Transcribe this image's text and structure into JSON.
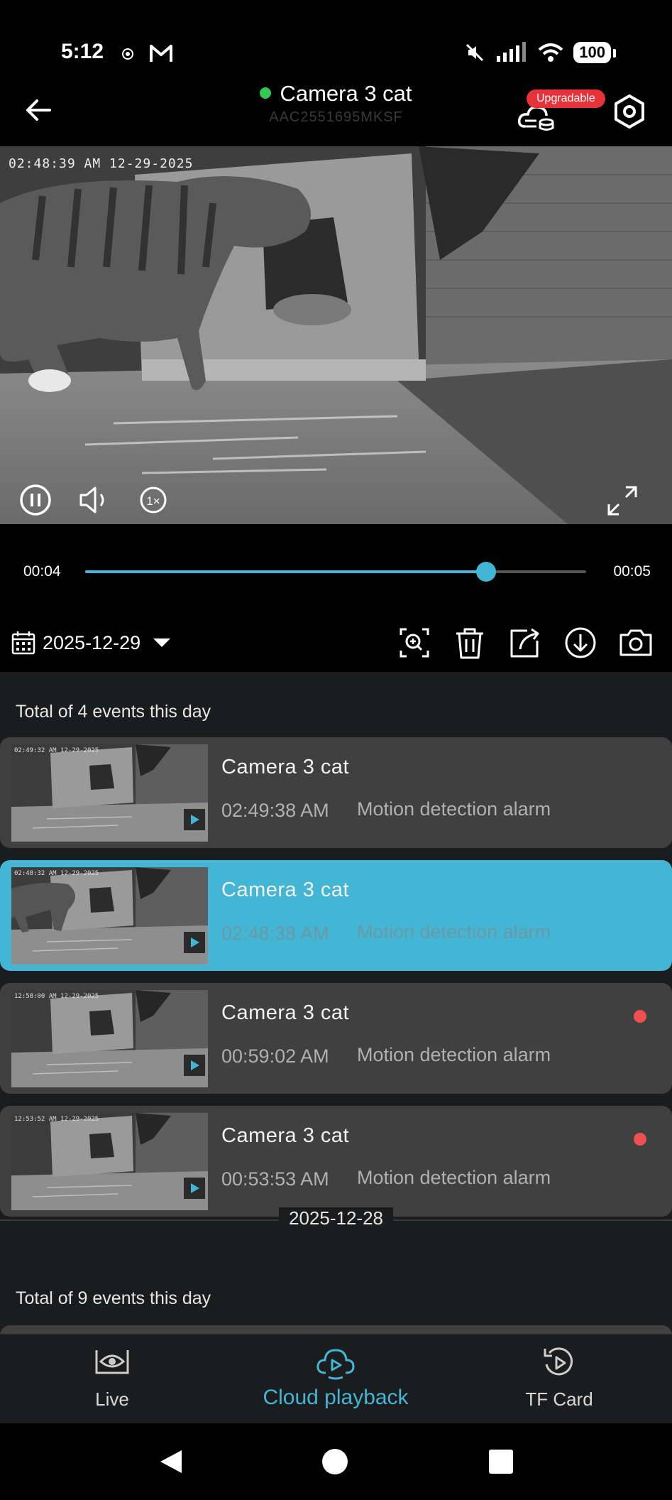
{
  "status_bar": {
    "time": "5:12",
    "battery": "100",
    "icons": [
      "notification-icon",
      "gmail-icon",
      "mute-icon",
      "signal-icon",
      "wifi-icon",
      "battery-icon"
    ]
  },
  "header": {
    "camera_name": "Camera 3 cat",
    "online_color": "#32c755",
    "serial": "AAC2551695MKSF",
    "badge": "Upgradable",
    "icons": [
      "back-arrow-icon",
      "cloud-storage-icon",
      "settings-hexagon-icon"
    ]
  },
  "video": {
    "timestamp_overlay": "02:48:39 AM 12-29-2025",
    "controls": [
      "pause-icon",
      "volume-icon",
      "speed-icon",
      "fullscreen-icon"
    ]
  },
  "playback": {
    "current": "00:04",
    "total": "00:05",
    "progress_fraction": 0.8,
    "accent": "#43b6d5"
  },
  "toolbar": {
    "date": "2025-12-29",
    "icons": [
      "calendar-icon",
      "dropdown-triangle-icon",
      "zoom-icon",
      "delete-icon",
      "share-icon",
      "download-icon",
      "snapshot-camera-icon"
    ]
  },
  "day1": {
    "total": "Total of 4 events this day",
    "events": [
      {
        "name": "Camera 3 cat",
        "time": "02:49:38 AM",
        "type": "Motion detection alarm",
        "thumb_osd": "02:49:32 AM 12-29-2025",
        "unread": false,
        "selected": false
      },
      {
        "name": "Camera 3 cat",
        "time": "02:48:38 AM",
        "type": "Motion detection alarm",
        "thumb_osd": "02:48:32 AM 12-29-2025",
        "unread": false,
        "selected": true
      },
      {
        "name": "Camera 3 cat",
        "time": "00:59:02 AM",
        "type": "Motion detection alarm",
        "thumb_osd": "12:58:00 AM 12-29-2025",
        "unread": true,
        "selected": false
      },
      {
        "name": "Camera 3 cat",
        "time": "00:53:53 AM",
        "type": "Motion detection alarm",
        "thumb_osd": "12:53:52 AM 12-29-2025",
        "unread": true,
        "selected": false
      }
    ]
  },
  "day2": {
    "date": "2025-12-28",
    "total": "Total of 9 events this day"
  },
  "bottom_nav": {
    "items": [
      {
        "label": "Live",
        "icon": "live-eye-icon",
        "active": false
      },
      {
        "label": "Cloud playback",
        "icon": "cloud-play-icon",
        "active": true
      },
      {
        "label": "TF Card",
        "icon": "tf-card-replay-icon",
        "active": false
      }
    ]
  },
  "system_nav": [
    "back-triangle-icon",
    "home-circle-icon",
    "recents-square-icon"
  ]
}
